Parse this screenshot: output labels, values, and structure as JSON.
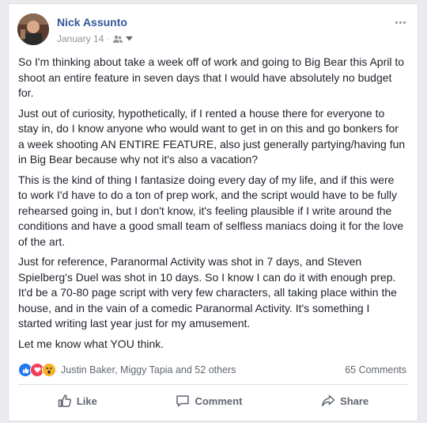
{
  "post": {
    "author": "Nick Assunto",
    "date": "January 14",
    "paragraphs": [
      "So I'm thinking about take a week off of work and going to Big Bear this April to shoot an entire feature in seven days that I would have absolutely no budget for.",
      "Just out of curiosity, hypothetically, if I rented a house there for everyone to stay in, do I know anyone who would want to get in on this and go bonkers for a week shooting AN ENTIRE FEATURE, also just generally partying/having fun in Big Bear because why not it's also a vacation?",
      "This is the kind of thing I fantasize doing every day of my life, and if this were to work I'd have to do a ton of prep work, and the script would have to be fully rehearsed going in, but I don't know, it's feeling plausible if I write around the conditions and have a good small team of selfless maniacs doing it for the love of the art.",
      "Just for reference, Paranormal Activity was shot in 7 days, and Steven Spielberg's Duel was shot in 10 days. So I know I can do it with enough prep. It'd be a 70-80 page script with very few characters, all taking place within the house, and in the vain of a comedic Paranormal Activity. It's something I started writing last year just for my amusement.",
      "Let me know what YOU think."
    ]
  },
  "reactions": {
    "icons": [
      "like-reaction-icon",
      "love-reaction-icon",
      "wow-reaction-icon"
    ],
    "summary": "Justin Baker, Miggy Tapia and 52 others",
    "comments": "65 Comments"
  },
  "actions": {
    "like": "Like",
    "comment": "Comment",
    "share": "Share"
  },
  "colors": {
    "name": "#365899",
    "meta": "#90949c",
    "like_blue": "#2078f4",
    "love_red": "#f33e58",
    "wow_yellow": "#f7b125"
  }
}
